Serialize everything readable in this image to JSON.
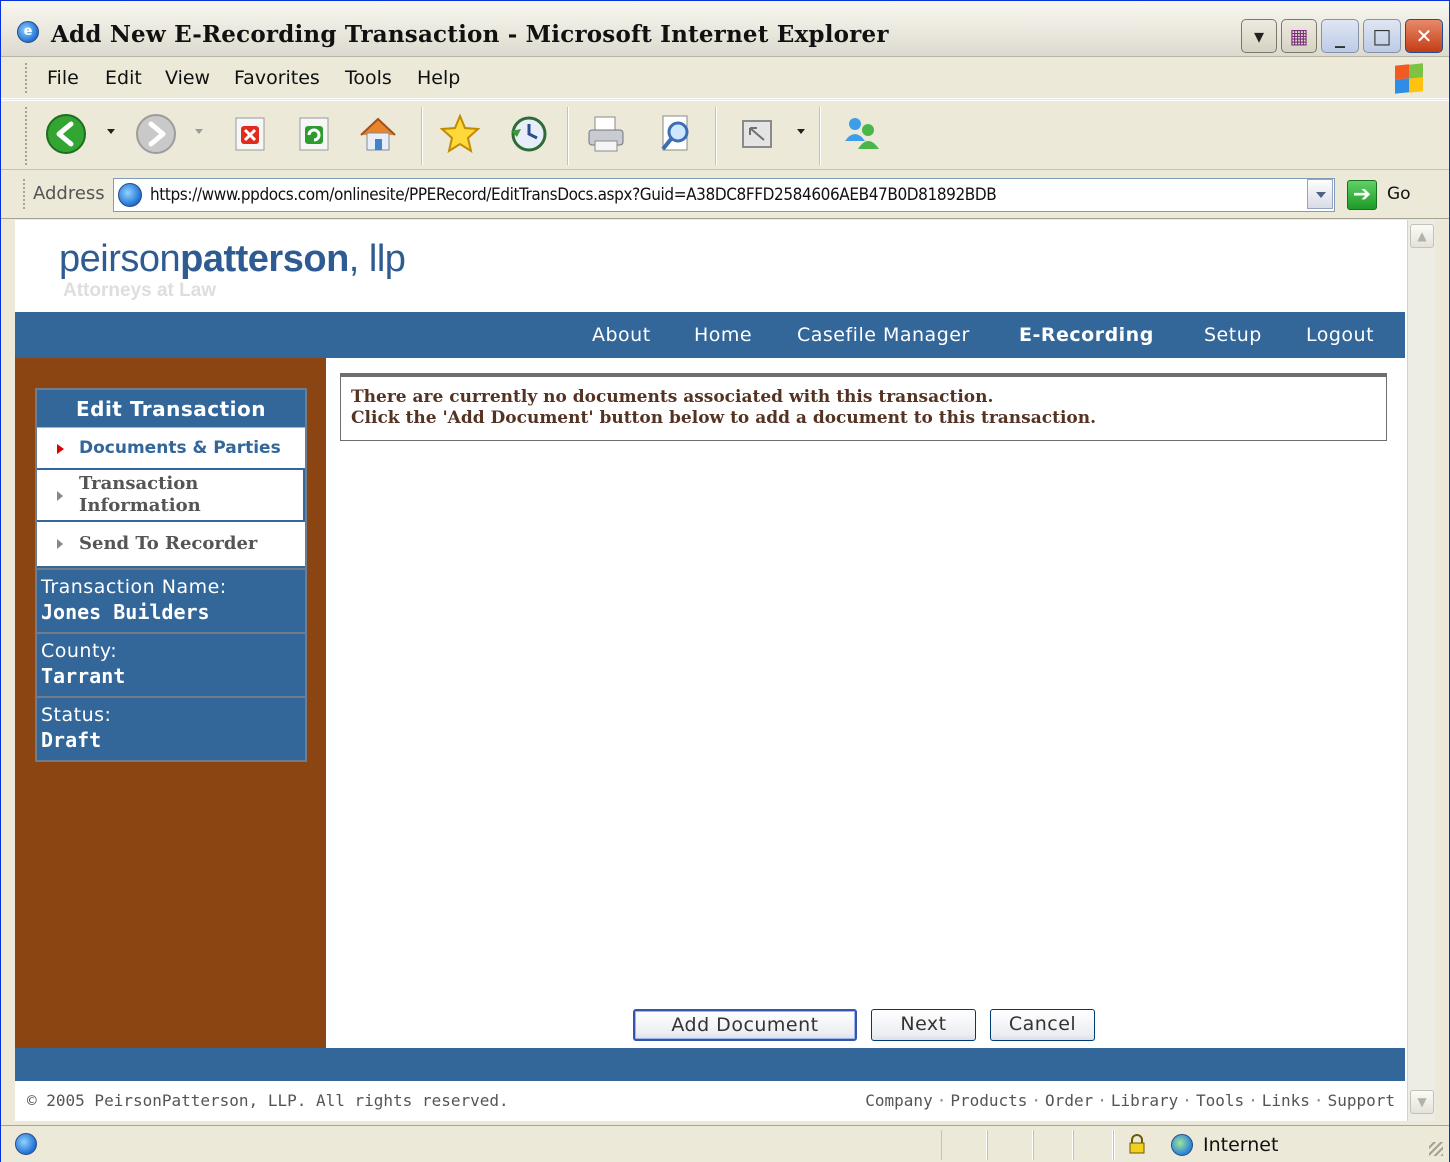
{
  "window": {
    "title": "Add New E-Recording Transaction - Microsoft Internet Explorer"
  },
  "menubar": {
    "items": [
      "File",
      "Edit",
      "View",
      "Favorites",
      "Tools",
      "Help"
    ]
  },
  "toolbar": {
    "icons": [
      "back-icon",
      "forward-icon",
      "stop-icon",
      "refresh-icon",
      "home-icon",
      "favorites-icon",
      "history-icon",
      "print-icon",
      "print-preview-icon",
      "window-icon",
      "messenger-icon"
    ]
  },
  "address": {
    "label": "Address",
    "url": "https://www.ppdocs.com/onlinesite/PPERecord/EditTransDocs.aspx?Guid=A38DC8FFD2584606AEB47B0D81892BDB",
    "go_label": "Go"
  },
  "site": {
    "logo_light": "peirson",
    "logo_bold": "patterson",
    "logo_suffix": ", llp",
    "tagline": "Attorneys at Law",
    "nav": [
      "About",
      "Home",
      "Casefile Manager",
      "E-Recording",
      "Setup",
      "Logout"
    ],
    "active_nav": "E-Recording"
  },
  "sidebar": {
    "heading": "Edit Transaction",
    "items": [
      {
        "label": "Documents & Parties",
        "active": true
      },
      {
        "label": "Transaction Information",
        "active": false
      },
      {
        "label": "Send To Recorder",
        "active": false
      }
    ],
    "transaction_name_label": "Transaction Name:",
    "transaction_name": "Jones Builders",
    "county_label": "County:",
    "county": "Tarrant",
    "status_label": "Status:",
    "status": "Draft"
  },
  "main": {
    "notice_line1": "There are currently no documents associated with this transaction.",
    "notice_line2": "Click the 'Add Document' button below to add a document to this transaction.",
    "add_document_label": "Add Document",
    "next_label": "Next",
    "cancel_label": "Cancel"
  },
  "footer": {
    "copyright": "© 2005 PeirsonPatterson, LLP. All rights reserved.",
    "links": [
      "Company",
      "Products",
      "Order",
      "Library",
      "Tools",
      "Links",
      "Support"
    ]
  },
  "statusbar": {
    "zone": "Internet"
  }
}
